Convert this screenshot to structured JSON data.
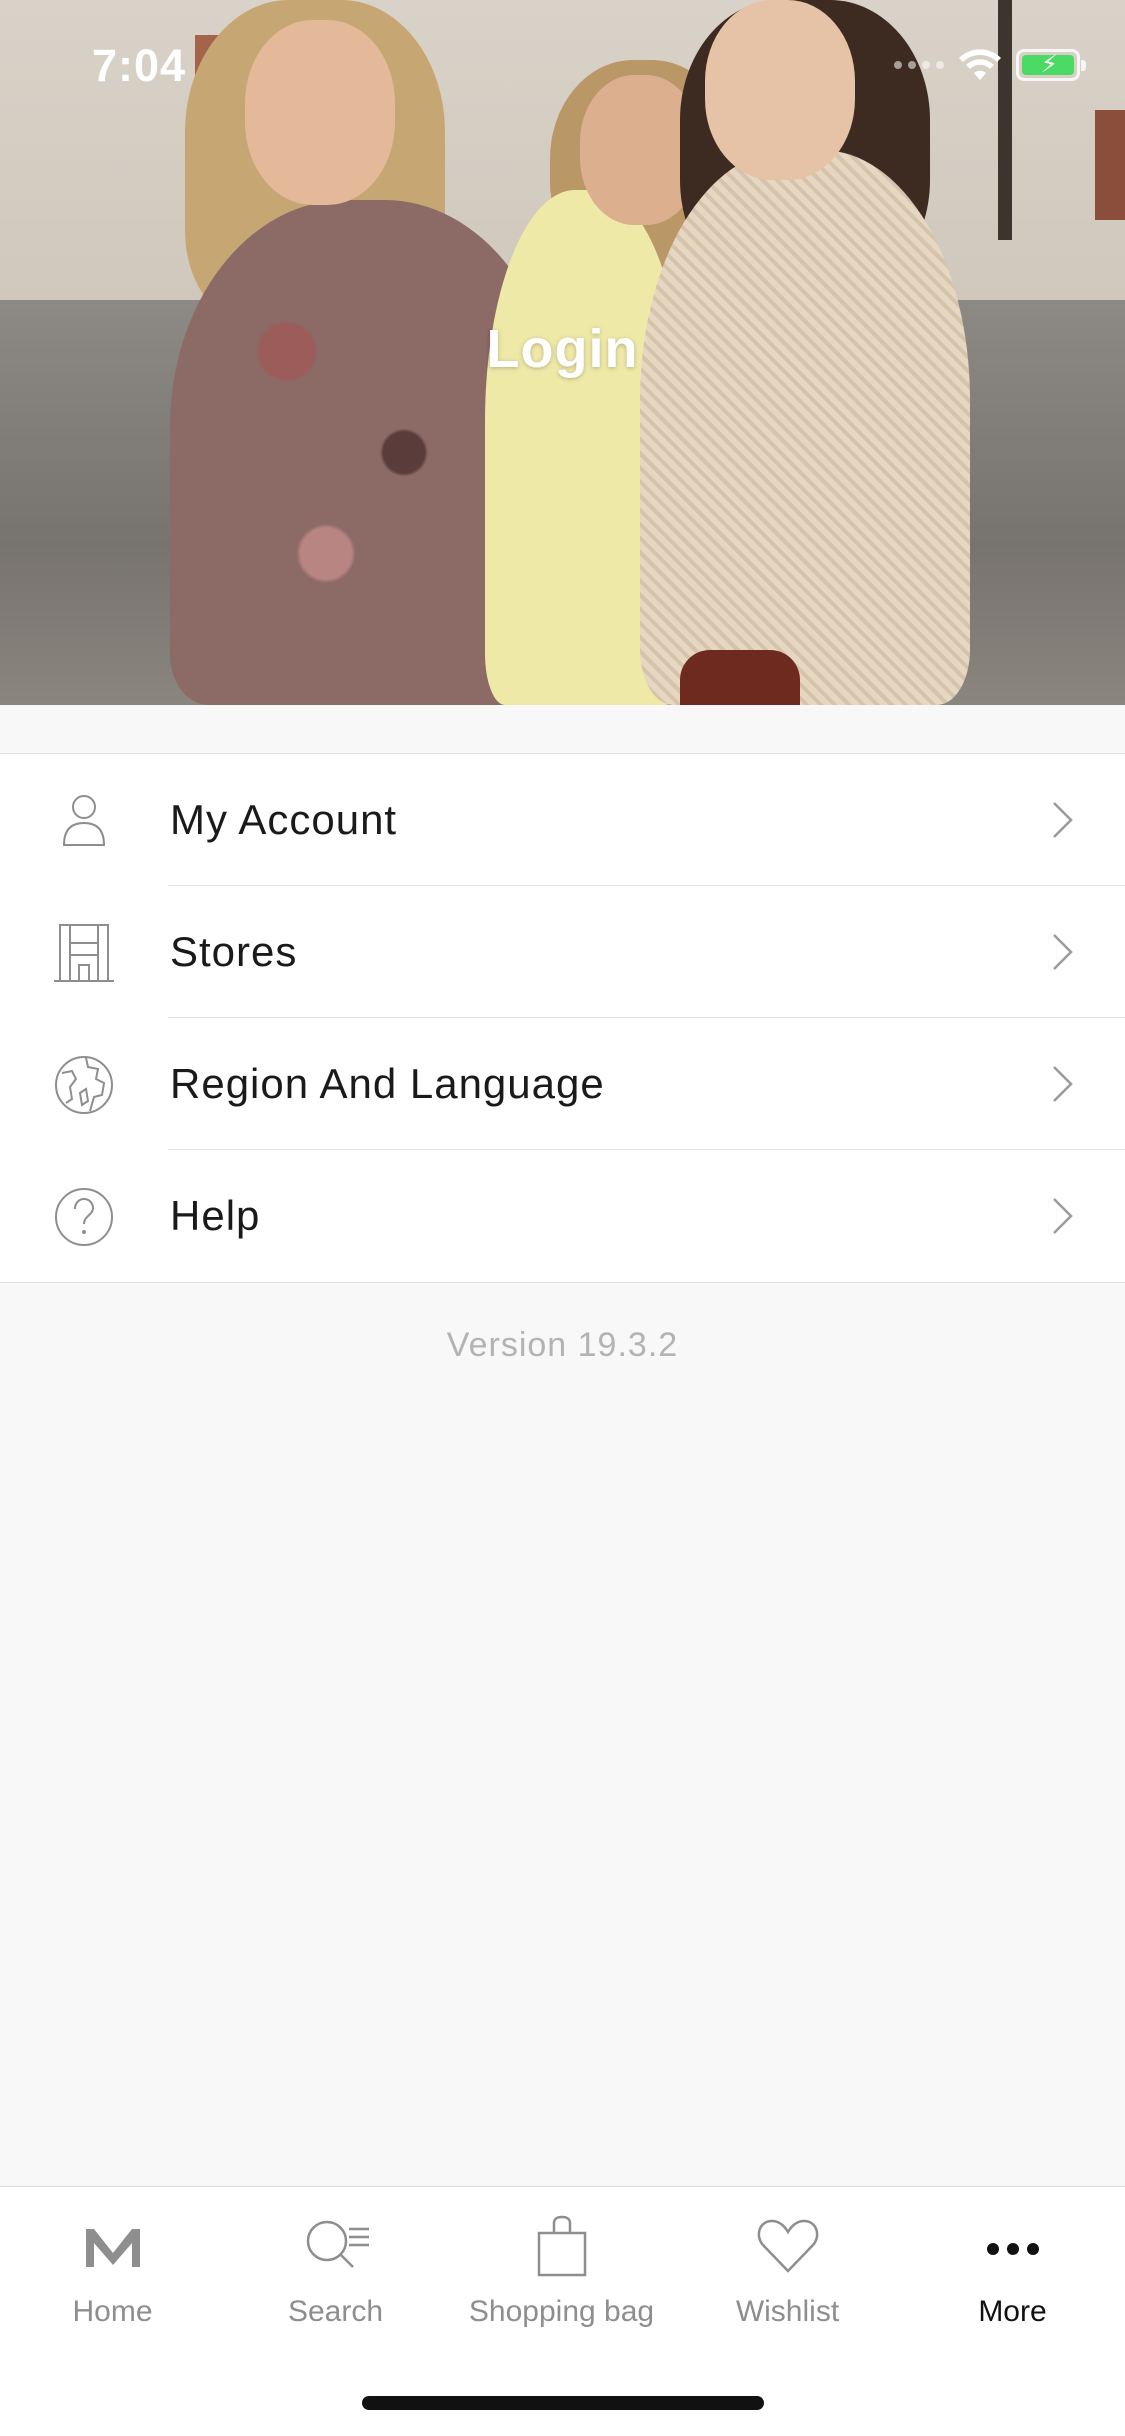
{
  "status_bar": {
    "time": "7:04"
  },
  "hero": {
    "title": "Login"
  },
  "menu": {
    "items": [
      {
        "label": "My Account",
        "icon": "person-icon"
      },
      {
        "label": "Stores",
        "icon": "store-icon"
      },
      {
        "label": "Region And Language",
        "icon": "globe-icon"
      },
      {
        "label": "Help",
        "icon": "help-icon"
      }
    ]
  },
  "version": "Version 19.3.2",
  "tabbar": {
    "tabs": [
      {
        "label": "Home",
        "icon": "mango-logo-icon",
        "active": false
      },
      {
        "label": "Search",
        "icon": "search-icon",
        "active": false
      },
      {
        "label": "Shopping bag",
        "icon": "shopping-bag-icon",
        "active": false
      },
      {
        "label": "Wishlist",
        "icon": "heart-icon",
        "active": false
      },
      {
        "label": "More",
        "icon": "more-dots-icon",
        "active": true
      }
    ]
  },
  "colors": {
    "battery": "#4cd964",
    "background": "#f8f8f8",
    "icon_gray": "#8e8e8e"
  }
}
